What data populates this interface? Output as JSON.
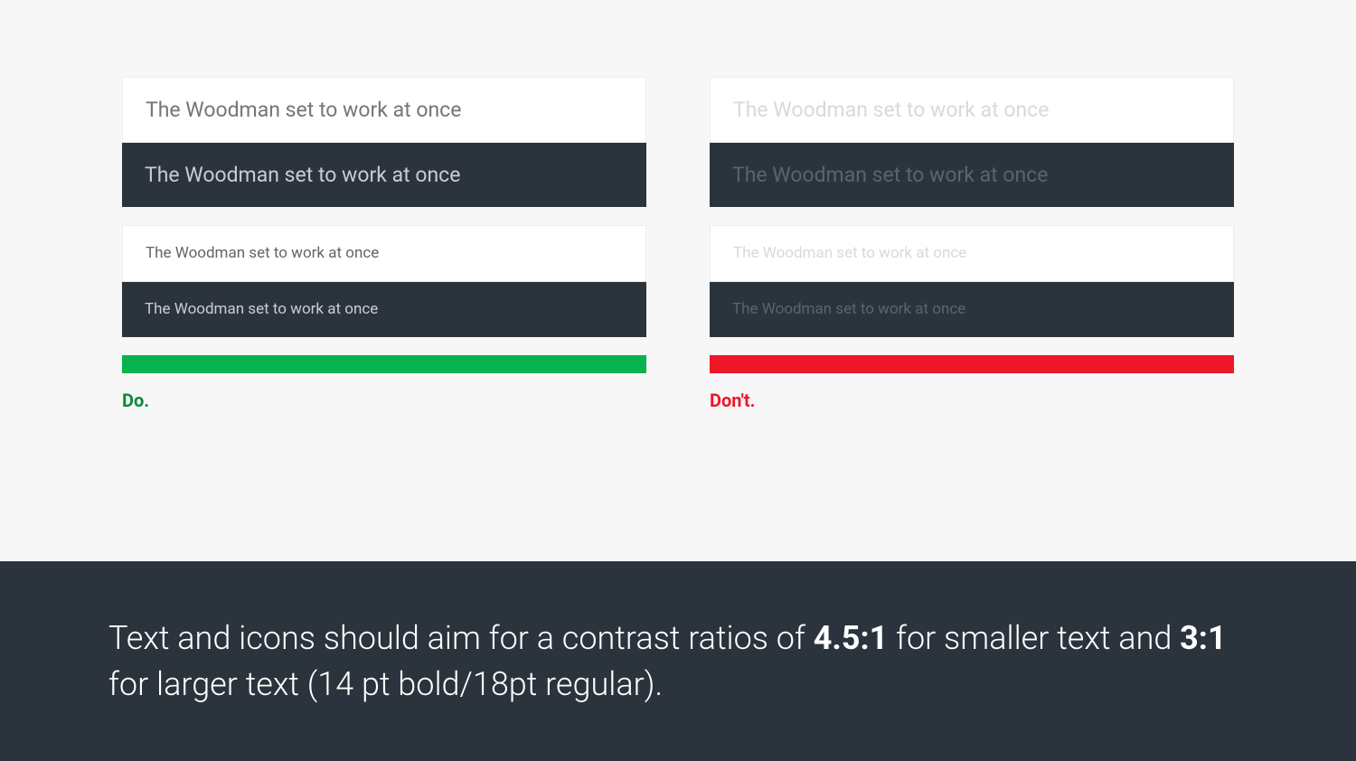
{
  "sample_text": "The Woodman set to work at once",
  "do_label": "Do.",
  "dont_label": "Don't.",
  "footer": {
    "part1": "Text and icons should aim for a contrast ratios of ",
    "ratio1": "4.5:1",
    "part2": " for smaller text and ",
    "ratio2": "3:1",
    "part3": " for larger text (14 pt bold/18pt regular)."
  },
  "colors": {
    "do": "#0ab24d",
    "dont": "#ed1727",
    "dark_bg": "#2b343c"
  }
}
